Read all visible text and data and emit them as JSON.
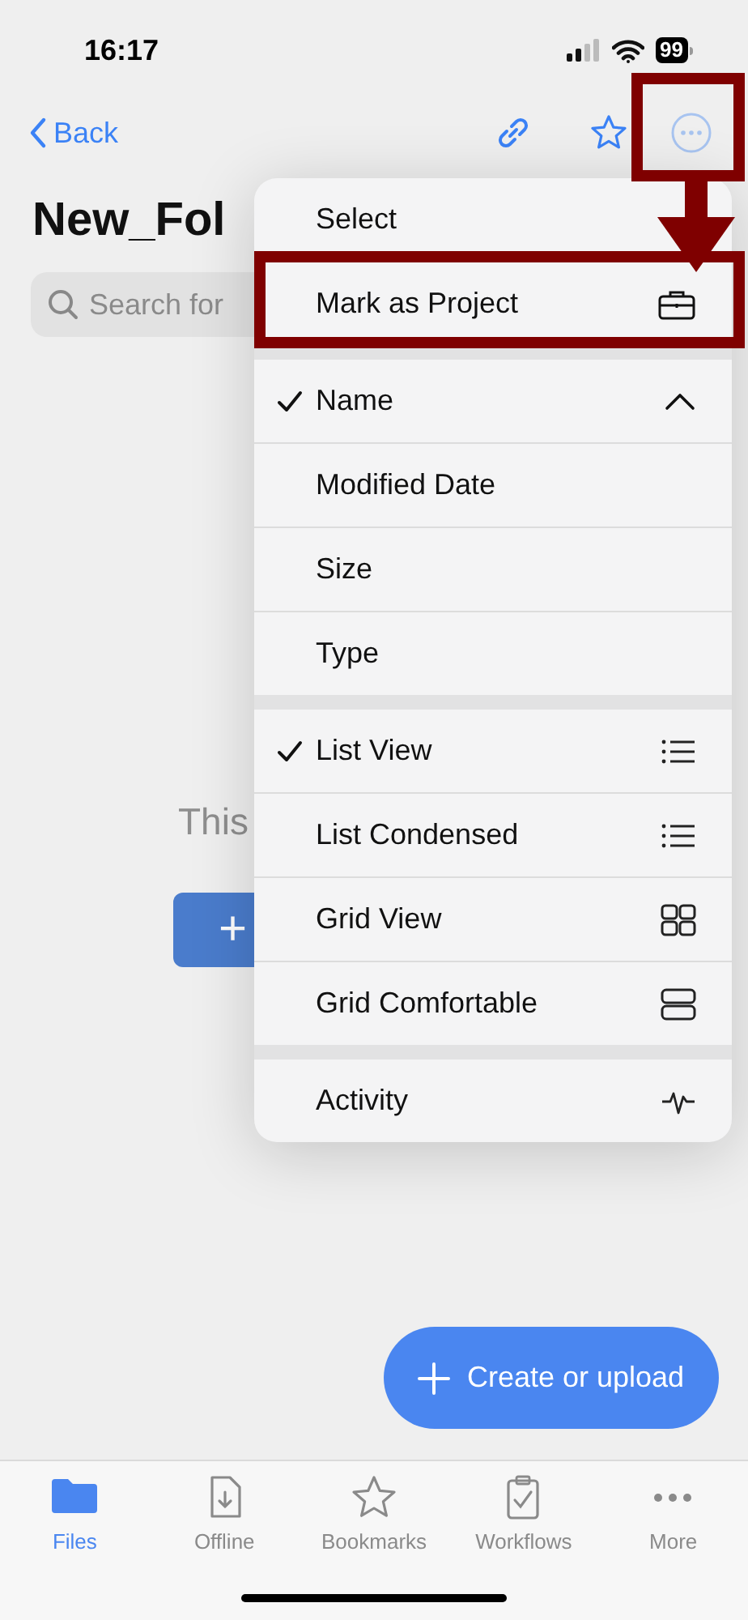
{
  "status_bar": {
    "time": "16:17",
    "battery": "99"
  },
  "nav": {
    "back": "Back",
    "more_highlighted": true
  },
  "title": "New_Fol",
  "search": {
    "placeholder": "Search for"
  },
  "empty_state": {
    "message": "This",
    "button": "+"
  },
  "menu": {
    "sections": [
      {
        "items": [
          {
            "label": "Select",
            "kind": "plain",
            "highlighted": false
          },
          {
            "label": "Mark as Project",
            "kind": "briefcase",
            "highlighted": true
          }
        ]
      },
      {
        "items": [
          {
            "label": "Name",
            "kind": "sort-up",
            "checked": true
          },
          {
            "label": "Modified Date",
            "kind": "plain",
            "checked": false
          },
          {
            "label": "Size",
            "kind": "plain",
            "checked": false
          },
          {
            "label": "Type",
            "kind": "plain",
            "checked": false
          }
        ]
      },
      {
        "items": [
          {
            "label": "List View",
            "kind": "list",
            "checked": true
          },
          {
            "label": "List Condensed",
            "kind": "list",
            "checked": false
          },
          {
            "label": "Grid View",
            "kind": "grid",
            "checked": false
          },
          {
            "label": "Grid Comfortable",
            "kind": "rows",
            "checked": false
          }
        ]
      },
      {
        "items": [
          {
            "label": "Activity",
            "kind": "pulse"
          }
        ]
      }
    ]
  },
  "annotations": [
    {
      "kind": "arrow"
    }
  ],
  "fab": {
    "label": "Create or upload"
  },
  "tabs": [
    {
      "label": "Files",
      "kind": "folder",
      "selected": true
    },
    {
      "label": "Offline",
      "kind": "download",
      "selected": false
    },
    {
      "label": "Bookmarks",
      "kind": "star",
      "selected": false
    },
    {
      "label": "Workflows",
      "kind": "clipboard",
      "selected": false
    },
    {
      "label": "More",
      "kind": "dots",
      "selected": false
    }
  ]
}
